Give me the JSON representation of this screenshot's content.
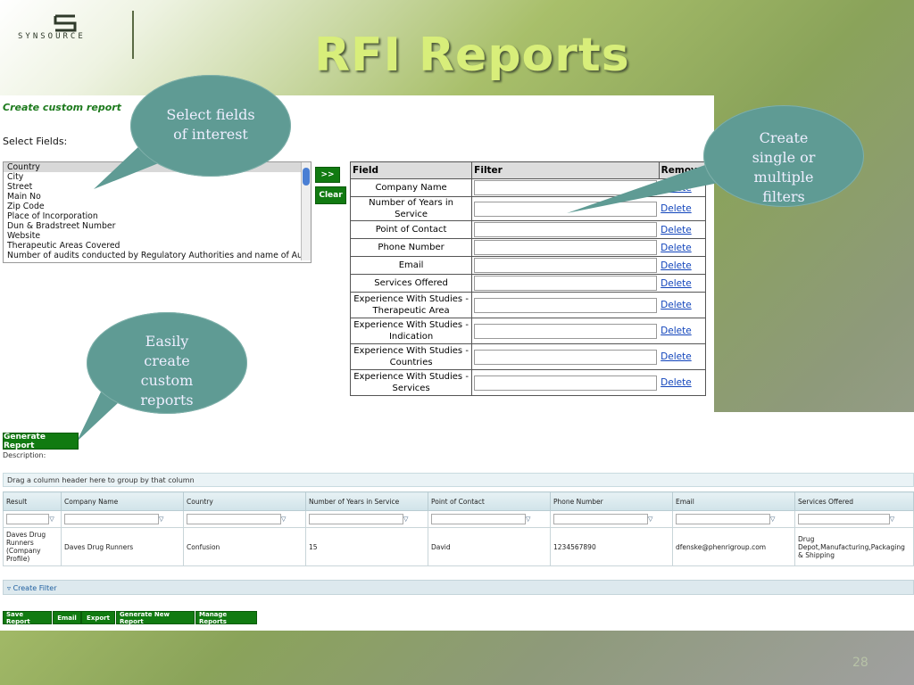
{
  "slide": {
    "title": "RFI Reports",
    "number": "28",
    "logo_text": "SYNSOURCE"
  },
  "builder": {
    "create_title": "Create custom report",
    "select_label": "Select Fields:",
    "fields": [
      "Country",
      "City",
      "Street",
      "Main No",
      "Zip Code",
      "Place of Incorporation",
      "Dun & Bradstreet Number",
      "Website",
      "Therapeutic Areas Covered",
      "Number of audits conducted by Regulatory Authorities and name of Authority"
    ],
    "add_label": ">>",
    "clear_label": "Clear",
    "generate_label": "Generate Report"
  },
  "filter_table": {
    "headers": [
      "Field",
      "Filter",
      "Remove"
    ],
    "rows": [
      {
        "field": "Company Name",
        "action": "Delete"
      },
      {
        "field": "Number of Years in Service",
        "action": "Delete"
      },
      {
        "field": "Point of Contact",
        "action": "Delete"
      },
      {
        "field": "Phone Number",
        "action": "Delete"
      },
      {
        "field": "Email",
        "action": "Delete"
      },
      {
        "field": "Services Offered",
        "action": "Delete"
      },
      {
        "field": "Experience With Studies - Therapeutic Area",
        "action": "Delete"
      },
      {
        "field": "Experience With Studies - Indication",
        "action": "Delete"
      },
      {
        "field": "Experience With Studies - Countries",
        "action": "Delete"
      },
      {
        "field": "Experience With Studies - Services",
        "action": "Delete"
      }
    ]
  },
  "callouts": {
    "select_fields": "Select fields of interest",
    "filters": "Create single or multiple filters",
    "custom": "Easily create custom reports"
  },
  "results": {
    "description": "Description:",
    "group_hint": "Drag a column header here to group by that column",
    "columns": [
      "Result",
      "Company Name",
      "Country",
      "Number of Years in Service",
      "Point of Contact",
      "Phone Number",
      "Email",
      "Services Offered"
    ],
    "row": [
      "Daves Drug Runners (Company Profile)",
      "Daves Drug Runners",
      "Confusion",
      "15",
      "David",
      "1234567890",
      "dfenske@phenrigroup.com",
      "Drug Depot,Manufacturing,Packaging & Shipping"
    ],
    "create_filter": "Create Filter",
    "buttons": [
      "Save Report",
      "Email",
      "Export",
      "Generate New Report",
      "Manage Reports"
    ]
  },
  "colors": {
    "accent_green": "#117a11",
    "title_color": "#d8ee7a",
    "bubble": "#5f9b94"
  }
}
